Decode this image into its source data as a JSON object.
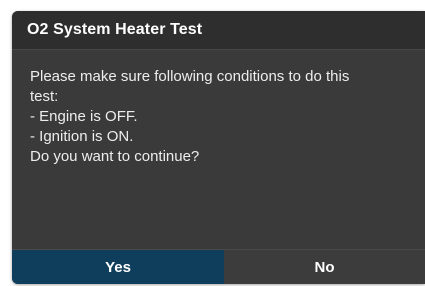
{
  "dialog": {
    "title": "O2 System Heater Test",
    "message_lines": [
      "Please make sure following conditions to do this",
      "test:",
      "- Engine is OFF.",
      "- Ignition is ON.",
      "Do you want to continue?"
    ],
    "buttons": {
      "yes_label": "Yes",
      "no_label": "No"
    }
  },
  "colors": {
    "dialog_background": "#3a3a3a",
    "title_background": "#2e2e2e",
    "primary_button": "#0f3e5d",
    "secondary_button": "#3c3c3c"
  }
}
